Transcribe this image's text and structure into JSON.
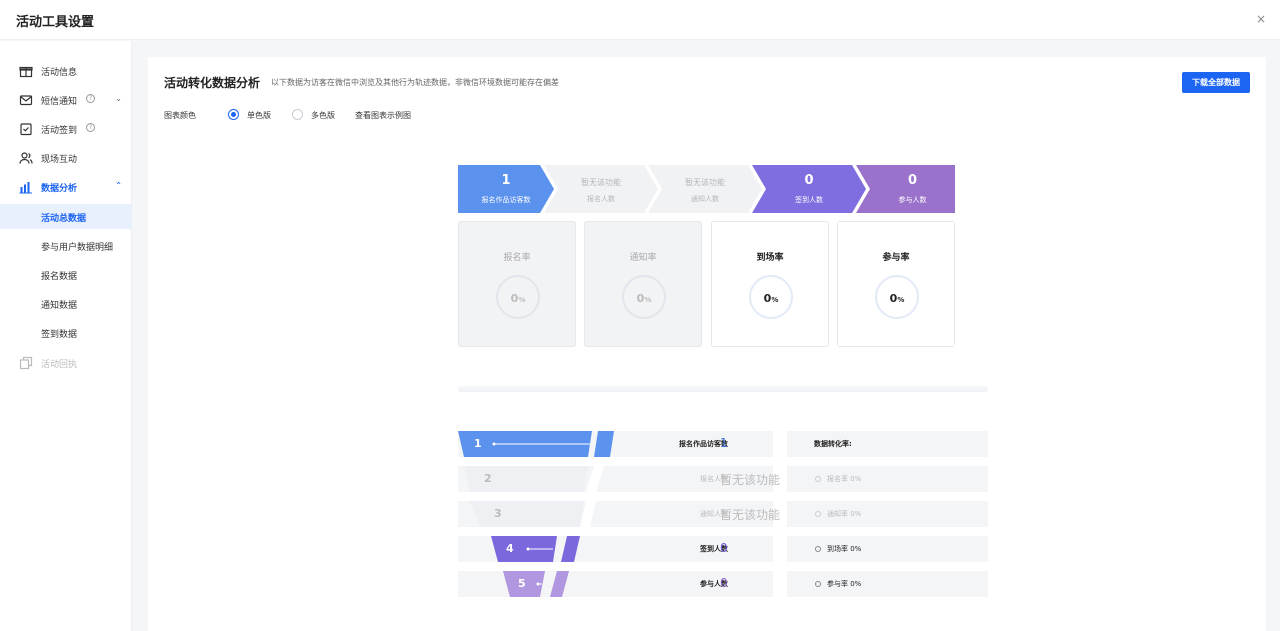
{
  "header": {
    "title": "活动工具设置",
    "close_label": "×"
  },
  "sidebar": {
    "items": [
      {
        "label": "活动信息",
        "icon": "gift-icon",
        "help": false
      },
      {
        "label": "短信通知",
        "icon": "mail-icon",
        "help": true,
        "chevron": "⌄"
      },
      {
        "label": "活动签到",
        "icon": "checkin-icon",
        "help": true
      },
      {
        "label": "现场互动",
        "icon": "users-icon",
        "help": false
      },
      {
        "label": "数据分析",
        "icon": "bar-chart-icon",
        "chevron": "⌃"
      },
      {
        "label": "活动回执",
        "icon": "receipt-icon",
        "disabled": true
      }
    ],
    "sub_items": [
      "活动总数据",
      "参与用户数据明细",
      "报名数据",
      "通知数据",
      "签到数据"
    ]
  },
  "main": {
    "title": "活动转化数据分析",
    "description": "以下数据为访客在微信中浏览及其他行为轨迹数据，非微信环境数据可能存在偏差",
    "download_label": "下载全部数据",
    "chart_color_label": "图表颜色",
    "mono_label": "单色版",
    "multi_label": "多色版",
    "example_link": "查看图表示例图",
    "selected_color_mode": "单色版"
  },
  "steps": [
    {
      "num": "1",
      "label": "报名作品访客数",
      "color": "#5b92ee"
    },
    {
      "text": "暂无该功能",
      "label": "报名人数",
      "color": "#f1f2f4"
    },
    {
      "text": "暂无该功能",
      "label": "通知人数",
      "color": "#f1f2f4"
    },
    {
      "num": "0",
      "label": "签到人数",
      "color": "#7f6ee0"
    },
    {
      "num": "0",
      "label": "参与人数",
      "color": "#9a72cc"
    }
  ],
  "cards": [
    {
      "title": "报名率",
      "value": "0",
      "unit": "%",
      "disabled": true
    },
    {
      "title": "通知率",
      "value": "0",
      "unit": "%",
      "disabled": true
    },
    {
      "title": "到场率",
      "value": "0",
      "unit": "%"
    },
    {
      "title": "参与率",
      "value": "0",
      "unit": "%"
    }
  ],
  "funnel": {
    "rows": [
      {
        "num": "1",
        "key": "报名作品访客数",
        "value": "1",
        "rate": "数据转化率:",
        "color": "#5b92ee"
      },
      {
        "num": "2",
        "key": "报名人数",
        "value": "暂无该功能",
        "rate": "报名率 0%",
        "dim": true
      },
      {
        "num": "3",
        "key": "通知人数",
        "value": "暂无该功能",
        "rate": "通知率 0%",
        "dim": true
      },
      {
        "num": "4",
        "key": "签到人数",
        "value": "0",
        "rate": "到场率 0%",
        "color": "#7b68dc"
      },
      {
        "num": "5",
        "key": "参与人数",
        "value": "0",
        "rate": "参与率 0%",
        "color": "#b196e0"
      }
    ]
  }
}
